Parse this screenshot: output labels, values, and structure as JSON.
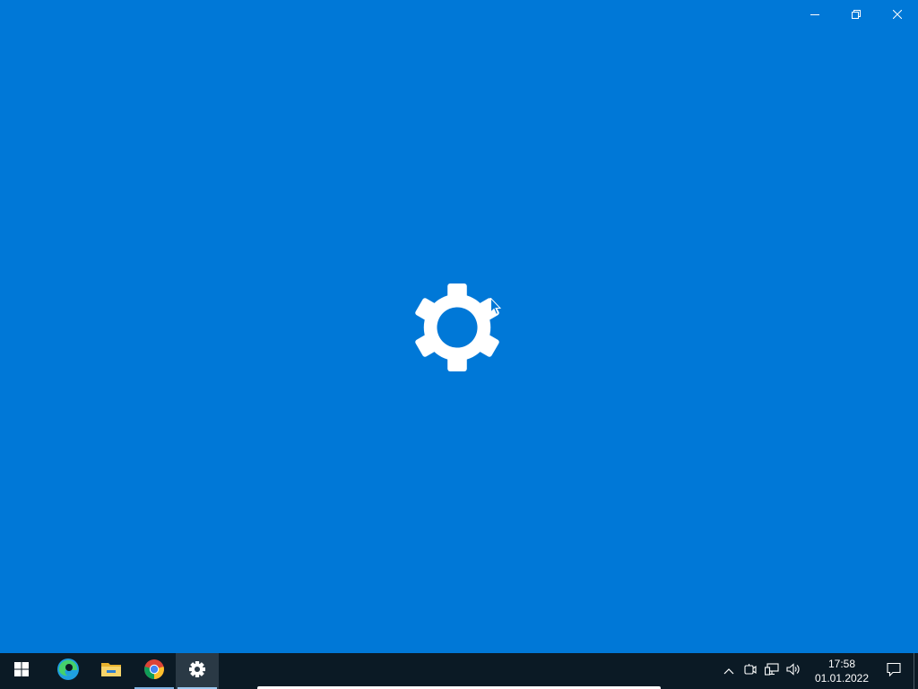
{
  "window": {
    "background": "#0078d7",
    "caption_buttons": [
      {
        "name": "minimize",
        "icon": "minimize-icon"
      },
      {
        "name": "restore",
        "icon": "restore-icon"
      },
      {
        "name": "close",
        "icon": "close-icon"
      }
    ],
    "splash_icon": "gear-icon"
  },
  "taskbar": {
    "background": "#0b1a25",
    "pinned": [
      {
        "name": "start",
        "icon": "windows-logo-icon",
        "running": false,
        "active": false
      },
      {
        "name": "edge",
        "icon": "edge-icon",
        "running": false,
        "active": false
      },
      {
        "name": "file-explorer",
        "icon": "folder-icon",
        "running": false,
        "active": false
      },
      {
        "name": "chrome",
        "icon": "chrome-icon",
        "running": true,
        "active": false
      },
      {
        "name": "settings",
        "icon": "gear-icon",
        "running": true,
        "active": true
      }
    ],
    "tray": {
      "icons": [
        "chevron-up-icon",
        "meet-now-icon",
        "network-icon",
        "volume-icon"
      ],
      "time": "17:58",
      "date": "01.01.2022",
      "notifications_icon": "action-center-icon"
    }
  }
}
